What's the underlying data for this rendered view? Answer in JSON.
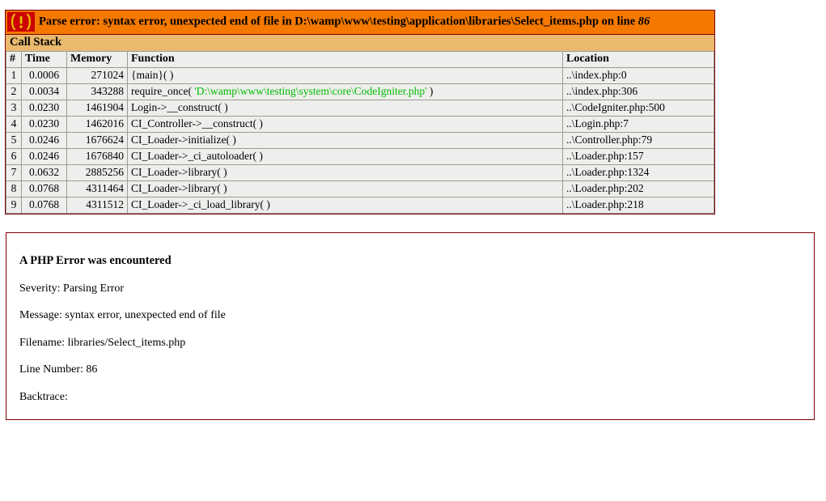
{
  "xdebug": {
    "icon": "error-exclamation-icon",
    "title_prefix": "Parse error: syntax error, unexpected end of file in D:\\wamp\\www\\testing\\application\\libraries\\Select_items.php on line ",
    "title_line_number": "86",
    "callstack_label": "Call Stack",
    "columns": {
      "num": "#",
      "time": "Time",
      "memory": "Memory",
      "function": "Function",
      "location": "Location"
    },
    "rows": [
      {
        "num": "1",
        "time": "0.0006",
        "memory": "271024",
        "function": "{main}( )",
        "fn_prefix": "",
        "fn_path": "",
        "fn_suffix": "",
        "location": "..\\index.php:0"
      },
      {
        "num": "2",
        "time": "0.0034",
        "memory": "343288",
        "function": "",
        "fn_prefix": "require_once( ",
        "fn_path": "'D:\\wamp\\www\\testing\\system\\core\\CodeIgniter.php'",
        "fn_suffix": " )",
        "location": "..\\index.php:306"
      },
      {
        "num": "3",
        "time": "0.0230",
        "memory": "1461904",
        "function": "Login->__construct( )",
        "fn_prefix": "",
        "fn_path": "",
        "fn_suffix": "",
        "location": "..\\CodeIgniter.php:500"
      },
      {
        "num": "4",
        "time": "0.0230",
        "memory": "1462016",
        "function": "CI_Controller->__construct( )",
        "fn_prefix": "",
        "fn_path": "",
        "fn_suffix": "",
        "location": "..\\Login.php:7"
      },
      {
        "num": "5",
        "time": "0.0246",
        "memory": "1676624",
        "function": "CI_Loader->initialize( )",
        "fn_prefix": "",
        "fn_path": "",
        "fn_suffix": "",
        "location": "..\\Controller.php:79"
      },
      {
        "num": "6",
        "time": "0.0246",
        "memory": "1676840",
        "function": "CI_Loader->_ci_autoloader( )",
        "fn_prefix": "",
        "fn_path": "",
        "fn_suffix": "",
        "location": "..\\Loader.php:157"
      },
      {
        "num": "7",
        "time": "0.0632",
        "memory": "2885256",
        "function": "CI_Loader->library( )",
        "fn_prefix": "",
        "fn_path": "",
        "fn_suffix": "",
        "location": "..\\Loader.php:1324"
      },
      {
        "num": "8",
        "time": "0.0768",
        "memory": "4311464",
        "function": "CI_Loader->library( )",
        "fn_prefix": "",
        "fn_path": "",
        "fn_suffix": "",
        "location": "..\\Loader.php:202"
      },
      {
        "num": "9",
        "time": "0.0768",
        "memory": "4311512",
        "function": "CI_Loader->_ci_load_library( )",
        "fn_prefix": "",
        "fn_path": "",
        "fn_suffix": "",
        "location": "..\\Loader.php:218"
      }
    ]
  },
  "php_error": {
    "heading": "A PHP Error was encountered",
    "severity": "Severity: Parsing Error",
    "message": "Message: syntax error, unexpected end of file",
    "filename": "Filename: libraries/Select_items.php",
    "line_number": "Line Number: 86",
    "backtrace": "Backtrace:"
  },
  "colors": {
    "header_orange": "#F57900",
    "callstack_tan": "#E9B96E",
    "icon_red": "#CC0000",
    "icon_glyph_gold": "#E8C000",
    "border_dark_red": "#7A0000",
    "row_gray": "#EEEEEC",
    "path_green": "#00BB00"
  }
}
